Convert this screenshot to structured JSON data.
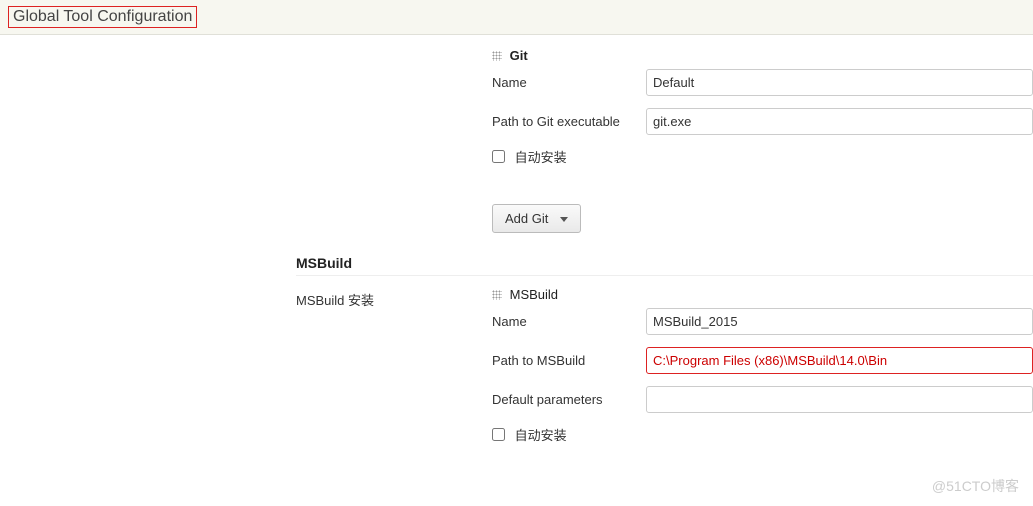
{
  "page": {
    "title": "Global Tool Configuration"
  },
  "git": {
    "instance_title": "Git",
    "name_label": "Name",
    "name_value": "Default",
    "path_label": "Path to Git executable",
    "path_value": "git.exe",
    "auto_install_label": "自动安装",
    "add_button": "Add Git"
  },
  "msbuild": {
    "section_title": "MSBuild",
    "install_label": "MSBuild 安装",
    "instance_title": "MSBuild",
    "name_label": "Name",
    "name_value": "MSBuild_2015",
    "path_label": "Path to MSBuild",
    "path_value": "C:\\Program Files (x86)\\MSBuild\\14.0\\Bin",
    "default_params_label": "Default parameters",
    "default_params_value": "",
    "auto_install_label": "自动安装"
  },
  "watermark": "@51CTO博客"
}
